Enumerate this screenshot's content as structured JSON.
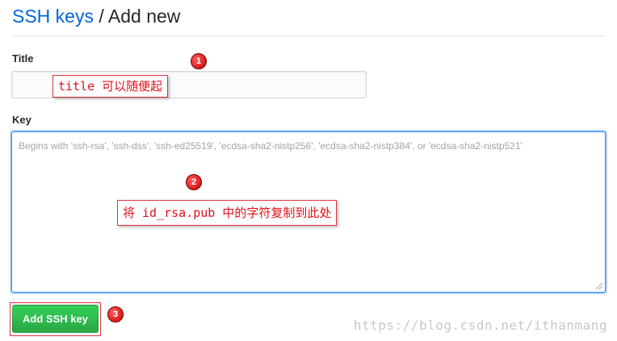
{
  "breadcrumb": {
    "link": "SSH keys",
    "separator": " / ",
    "current": "Add new"
  },
  "form": {
    "title_label": "Title",
    "title_value": "",
    "key_label": "Key",
    "key_placeholder": "Begins with 'ssh-rsa', 'ssh-dss', 'ssh-ed25519', 'ecdsa-sha2-nistp256', 'ecdsa-sha2-nistp384', or 'ecdsa-sha2-nistp521'",
    "submit_label": "Add SSH key"
  },
  "annotations": {
    "note1": "title 可以随便起",
    "note2": "将 id_rsa.pub 中的字符复制到此处",
    "markers": [
      "1",
      "2",
      "3"
    ]
  },
  "watermark": "https://blog.csdn.net/ithanmang",
  "colors": {
    "link": "#0366d6",
    "button_green": "#28a745",
    "annotation_red": "#e0101a",
    "focus_border": "#2188ff"
  }
}
